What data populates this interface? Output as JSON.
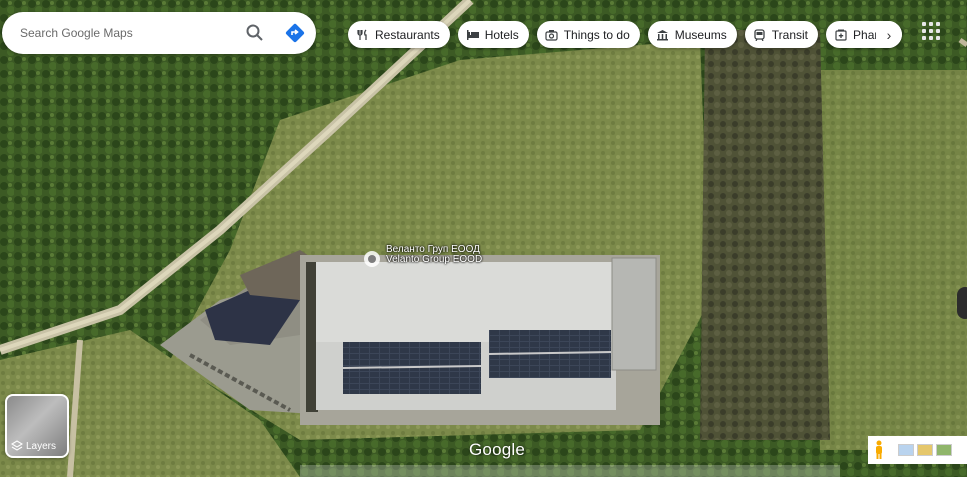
{
  "search": {
    "placeholder": "Search Google Maps"
  },
  "chips": [
    {
      "label": "Restaurants",
      "icon": "fork-knife-icon"
    },
    {
      "label": "Hotels",
      "icon": "bed-icon"
    },
    {
      "label": "Things to do",
      "icon": "camera-icon"
    },
    {
      "label": "Museums",
      "icon": "museum-icon"
    },
    {
      "label": "Transit",
      "icon": "transit-icon"
    },
    {
      "label": "Phar",
      "icon": "pharmacy-icon"
    }
  ],
  "place": {
    "name_cyrillic": "Веланто Груп ЕООД",
    "name_latin": "Velanto Group EOOD"
  },
  "layers": {
    "label": "Layers"
  },
  "brand": {
    "logo_text": "Google"
  },
  "colors": {
    "directions_blue": "#1a73e8",
    "pegman_orange": "#f9ab00",
    "map_green": "#4e6b2f"
  }
}
